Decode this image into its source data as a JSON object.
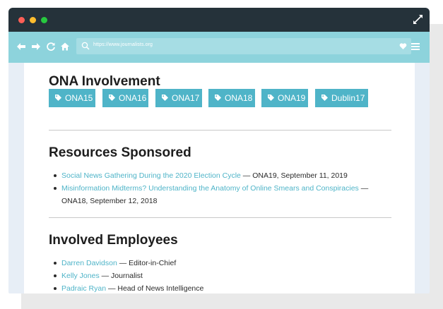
{
  "browser": {
    "url": "https://www.journalists.org",
    "icons": [
      "back-arrow-icon",
      "forward-arrow-icon",
      "reload-icon",
      "home-icon",
      "search-icon",
      "heart-icon",
      "menu-icon",
      "expand-icon"
    ]
  },
  "colors": {
    "titlebar": "#25323a",
    "toolbar": "#8dd3dc",
    "accent": "#4fb4c8"
  },
  "sections": {
    "involvement": {
      "heading": "ONA Involvement",
      "tags": [
        "ONA15",
        "ONA16",
        "ONA17",
        "ONA18",
        "ONA19",
        "Dublin17"
      ]
    },
    "resources": {
      "heading": "Resources Sponsored",
      "items": [
        {
          "link": "Social News Gathering During the 2020 Election Cycle",
          "detail": " — ONA19, September 11, 2019"
        },
        {
          "link": "Misinformation Midterms? Understanding the Anatomy of Online Smears and Conspiracies",
          "detail": " — ONA18, September 12, 2018"
        }
      ]
    },
    "employees": {
      "heading": "Involved Employees",
      "items": [
        {
          "name": "Darren Davidson",
          "role": " — Editor-in-Chief"
        },
        {
          "name": "Kelly Jones",
          "role": " — Journalist"
        },
        {
          "name": "Padraic Ryan",
          "role": " — Head of News Intelligence"
        }
      ]
    }
  }
}
